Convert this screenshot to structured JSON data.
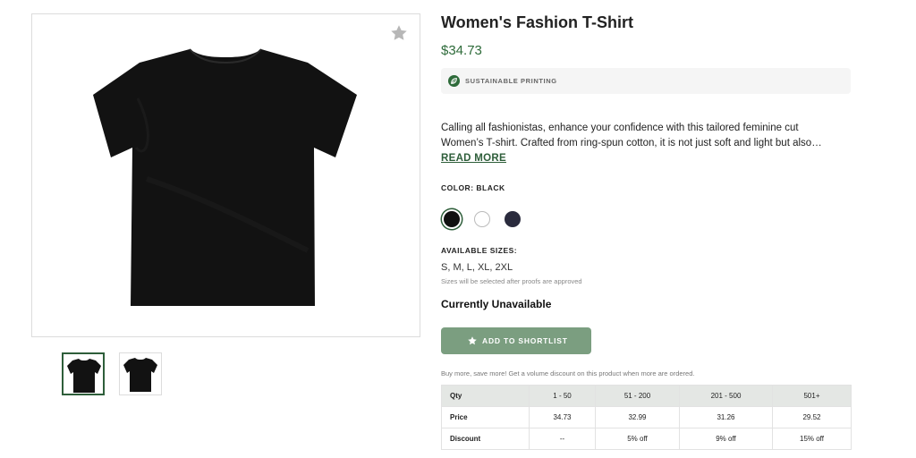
{
  "product": {
    "title": "Women's Fashion T-Shirt",
    "price": "$34.73",
    "badge": "SUSTAINABLE PRINTING",
    "description_line1": "Calling all fashionistas, enhance your confidence with this tailored feminine cut",
    "description_line2": "Women’s T-shirt. Crafted from ring-spun cotton, it is not just soft and light but also…",
    "read_more": "READ MORE"
  },
  "color": {
    "label": "COLOR:",
    "selected": "BLACK",
    "swatches": [
      {
        "name": "Black",
        "hex": "#111111"
      },
      {
        "name": "White",
        "hex": "#ffffff"
      },
      {
        "name": "Navy",
        "hex": "#2a2b3d"
      }
    ]
  },
  "sizes": {
    "label": "AVAILABLE SIZES:",
    "value": "S, M, L, XL, 2XL",
    "note": "Sizes will be selected after proofs are approved"
  },
  "availability": "Currently Unavailable",
  "shortlist_button": "ADD TO SHORTLIST",
  "volume": {
    "note": "Buy more, save more! Get a volume discount on this product when more are ordered.",
    "headers": [
      "Qty",
      "1 - 50",
      "51 - 200",
      "201 - 500",
      "501+"
    ],
    "rows": [
      [
        "Price",
        "34.73",
        "32.99",
        "31.26",
        "29.52"
      ],
      [
        "Discount",
        "--",
        "5% off",
        "9% off",
        "15% off"
      ]
    ]
  },
  "icons": {
    "favorite": "star-icon",
    "badge": "leaf-icon",
    "button": "star-icon"
  },
  "colors": {
    "accent_green": "#2e6b3a",
    "button_green": "#7b9e80"
  }
}
